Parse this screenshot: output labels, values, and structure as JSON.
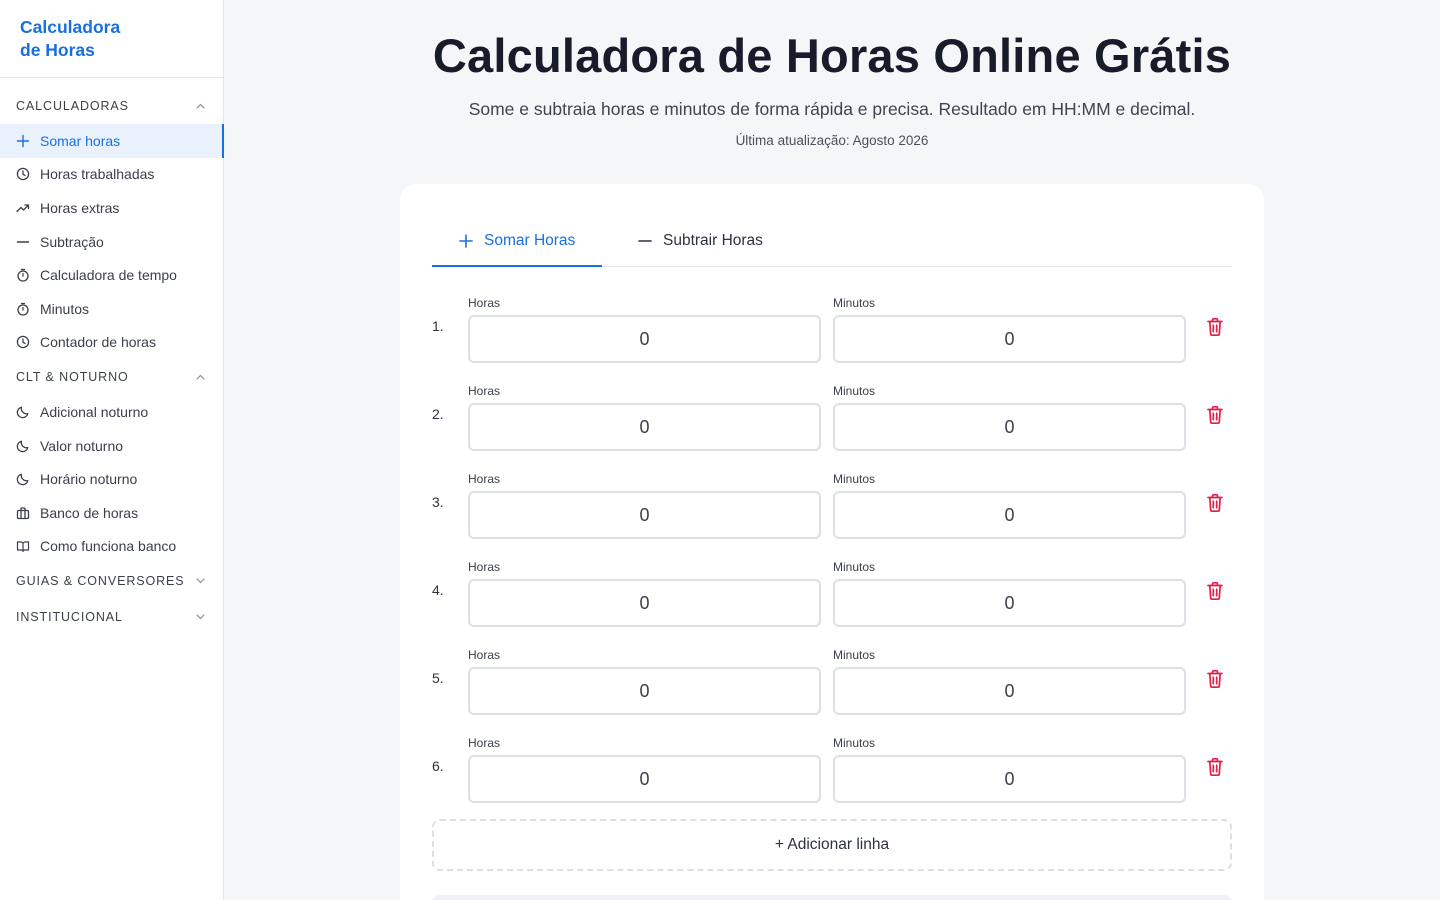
{
  "sidebar": {
    "brand_line1": "Calculadora",
    "brand_line2": "de Horas",
    "sections": [
      {
        "title": "CALCULADORAS",
        "expanded": true,
        "items": [
          {
            "label": "Somar horas",
            "icon": "plus-icon",
            "active": true
          },
          {
            "label": "Horas trabalhadas",
            "icon": "clock-icon"
          },
          {
            "label": "Horas extras",
            "icon": "trending-up-icon"
          },
          {
            "label": "Subtração",
            "icon": "minus-icon"
          },
          {
            "label": "Calculadora de tempo",
            "icon": "stopwatch-icon"
          },
          {
            "label": "Minutos",
            "icon": "stopwatch-icon"
          },
          {
            "label": "Contador de horas",
            "icon": "clock-icon"
          }
        ]
      },
      {
        "title": "CLT & NOTURNO",
        "expanded": true,
        "items": [
          {
            "label": "Adicional noturno",
            "icon": "moon-icon"
          },
          {
            "label": "Valor noturno",
            "icon": "moon-icon"
          },
          {
            "label": "Horário noturno",
            "icon": "moon-icon"
          },
          {
            "label": "Banco de horas",
            "icon": "briefcase-icon"
          },
          {
            "label": "Como funciona banco",
            "icon": "book-icon"
          }
        ]
      },
      {
        "title": "GUIAS & CONVERSORES",
        "expanded": false
      },
      {
        "title": "INSTITUCIONAL",
        "expanded": false
      }
    ]
  },
  "header": {
    "title": "Calculadora de Horas Online Grátis",
    "subtitle": "Some e subtraia horas e minutos de forma rápida e precisa. Resultado em HH:MM e decimal.",
    "updated": "Última atualização: Agosto 2026"
  },
  "tabs": [
    {
      "label": "Somar Horas",
      "icon": "plus-icon",
      "active": true
    },
    {
      "label": "Subtrair Horas",
      "icon": "minus-icon",
      "active": false
    }
  ],
  "form": {
    "hours_label": "Horas",
    "minutes_label": "Minutos",
    "rows": [
      {
        "num": "1.",
        "hours": "0",
        "minutes": "0"
      },
      {
        "num": "2.",
        "hours": "0",
        "minutes": "0"
      },
      {
        "num": "3.",
        "hours": "0",
        "minutes": "0"
      },
      {
        "num": "4.",
        "hours": "0",
        "minutes": "0"
      },
      {
        "num": "5.",
        "hours": "0",
        "minutes": "0"
      },
      {
        "num": "6.",
        "hours": "0",
        "minutes": "0"
      }
    ],
    "add_row_label": "+ Adicionar linha"
  },
  "colors": {
    "accent": "#1a6fe0",
    "danger": "#e11d48",
    "active_bg": "#e9f1fc"
  }
}
